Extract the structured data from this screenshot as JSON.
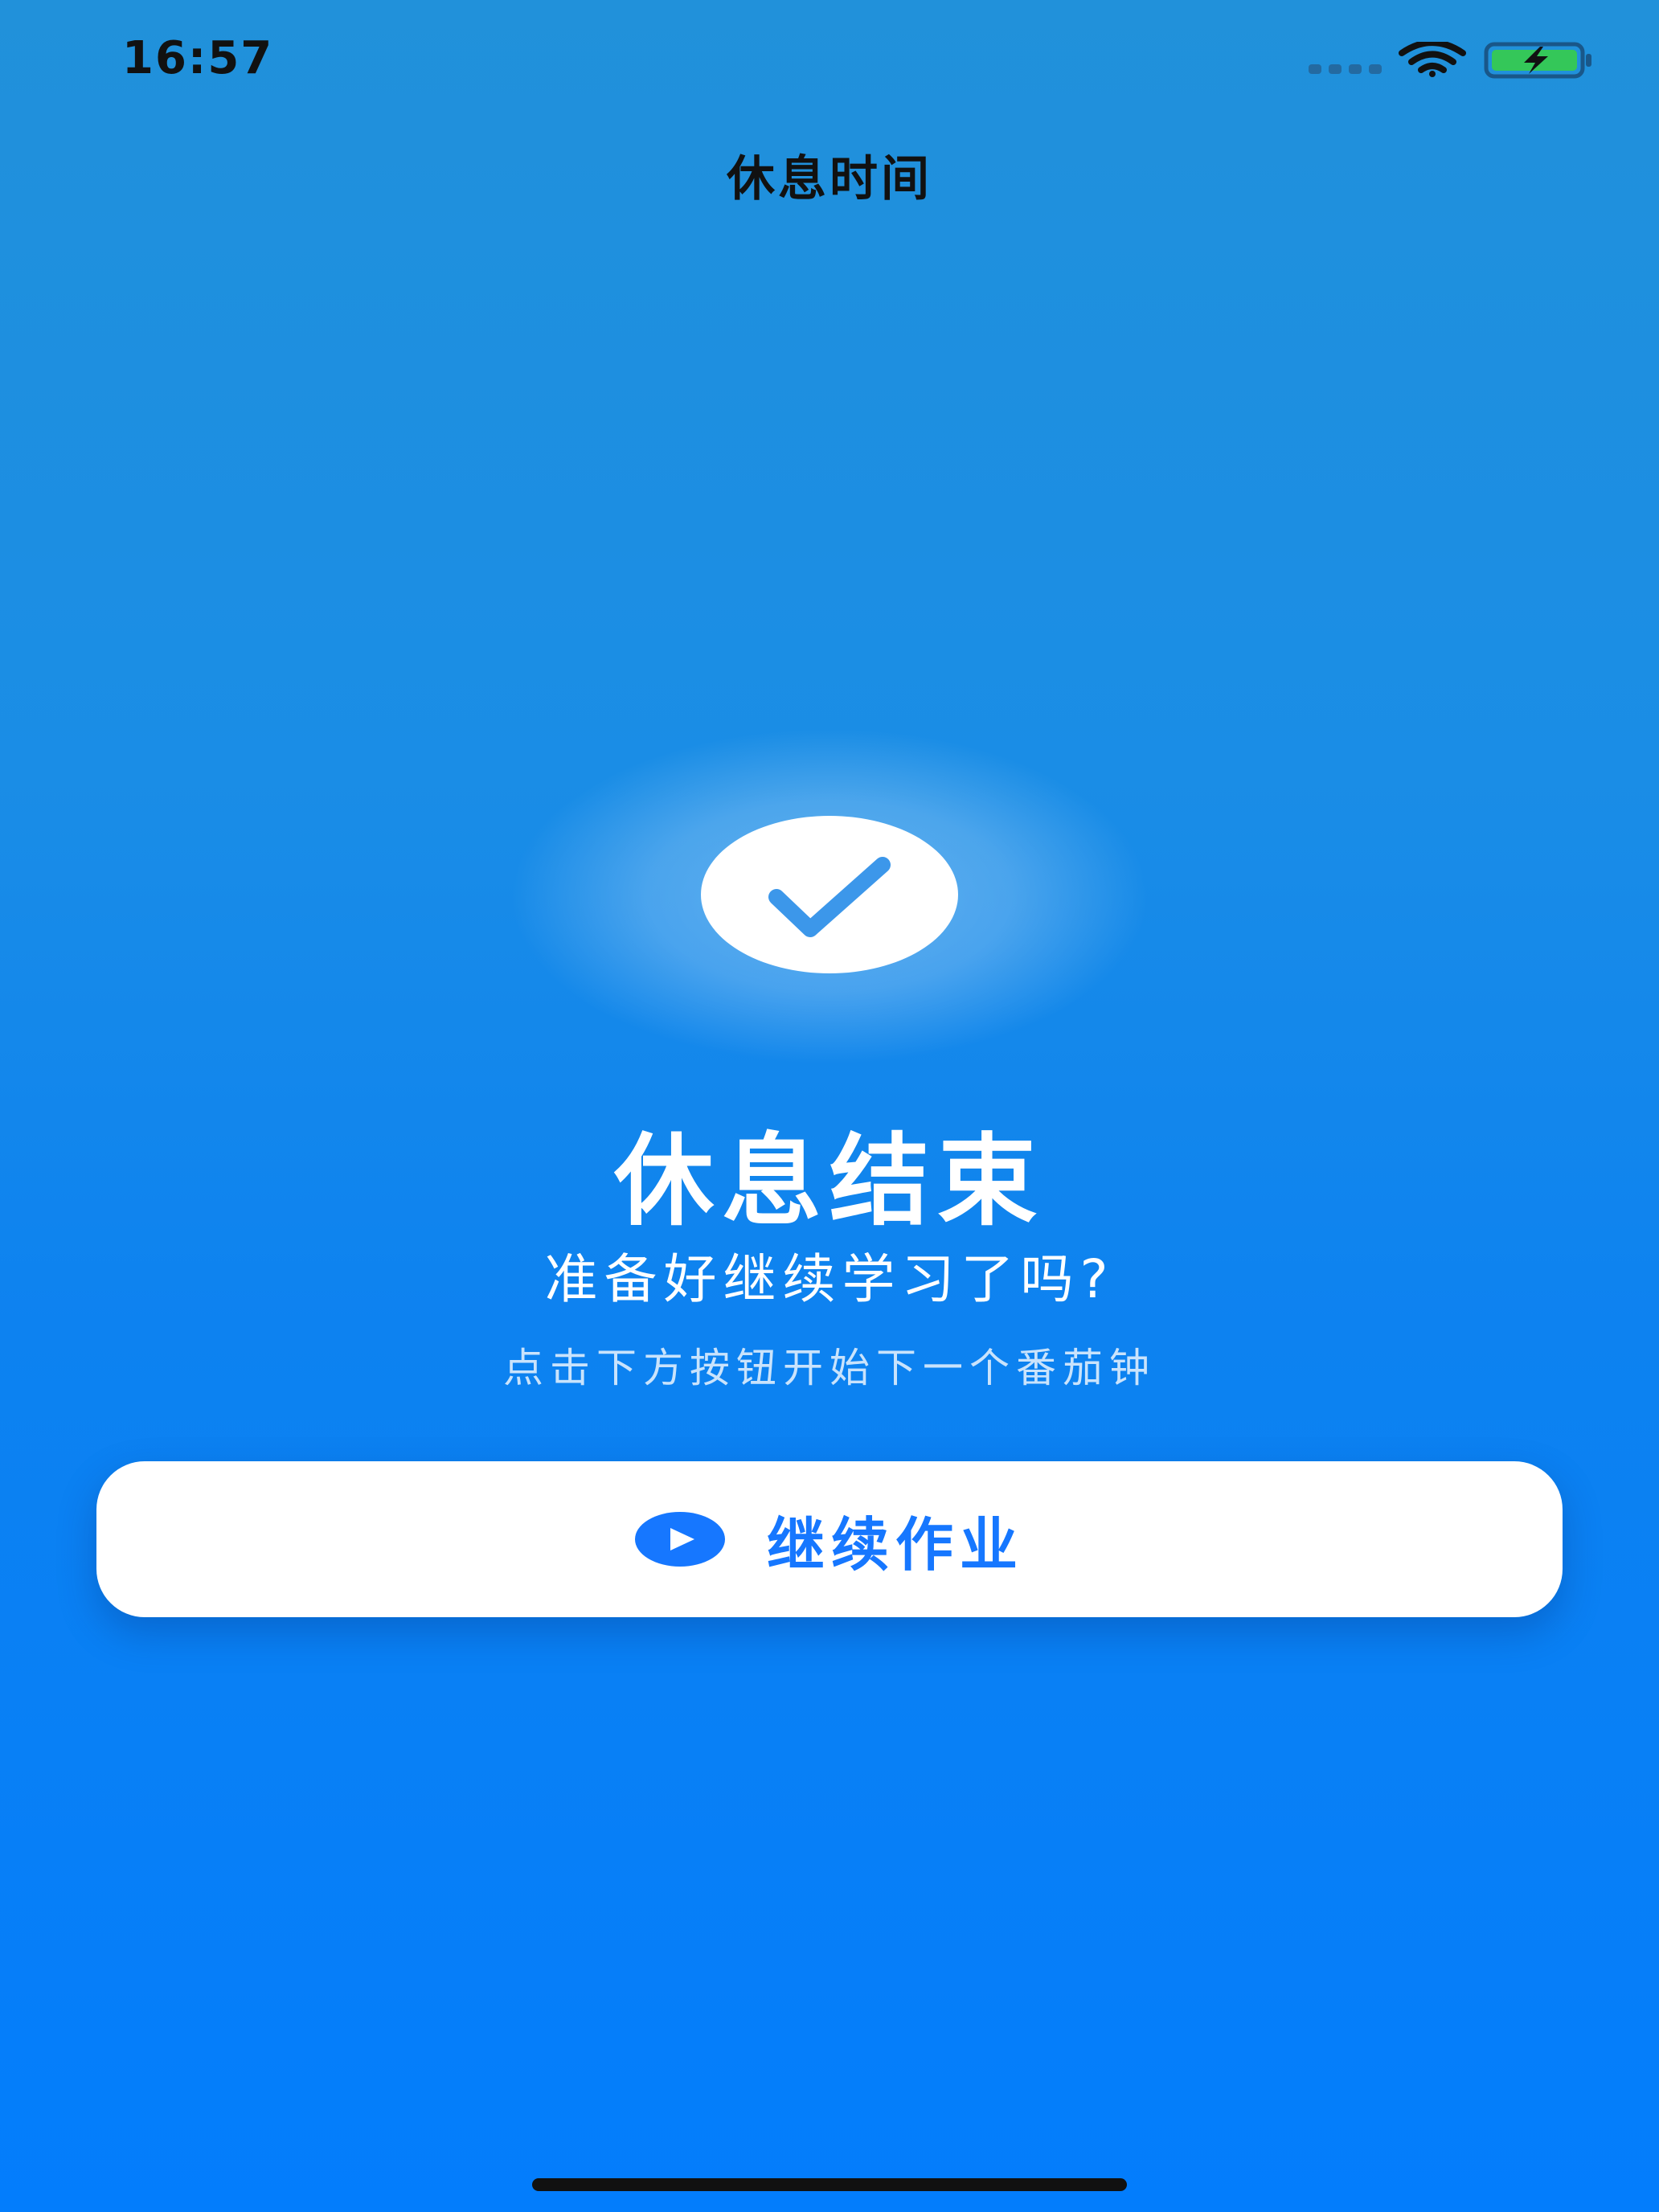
{
  "status_bar": {
    "time": "16:57",
    "signal_icon": "cellular-signal-icon",
    "wifi_icon": "wifi-icon",
    "battery_icon": "battery-charging-icon",
    "battery_color": "#34c759"
  },
  "header": {
    "title": "休息时间"
  },
  "main": {
    "status_icon": "checkmark-icon",
    "title": "休息结束",
    "subtitle": "准备好继续学习了吗?",
    "hint": "点击下方按钮开始下一个番茄钟"
  },
  "actions": {
    "continue_label": "继续作业",
    "continue_icon": "play-circle-icon"
  },
  "colors": {
    "background_top": "#2191da",
    "background_bottom": "#037dfc",
    "accent": "#1677ff"
  }
}
